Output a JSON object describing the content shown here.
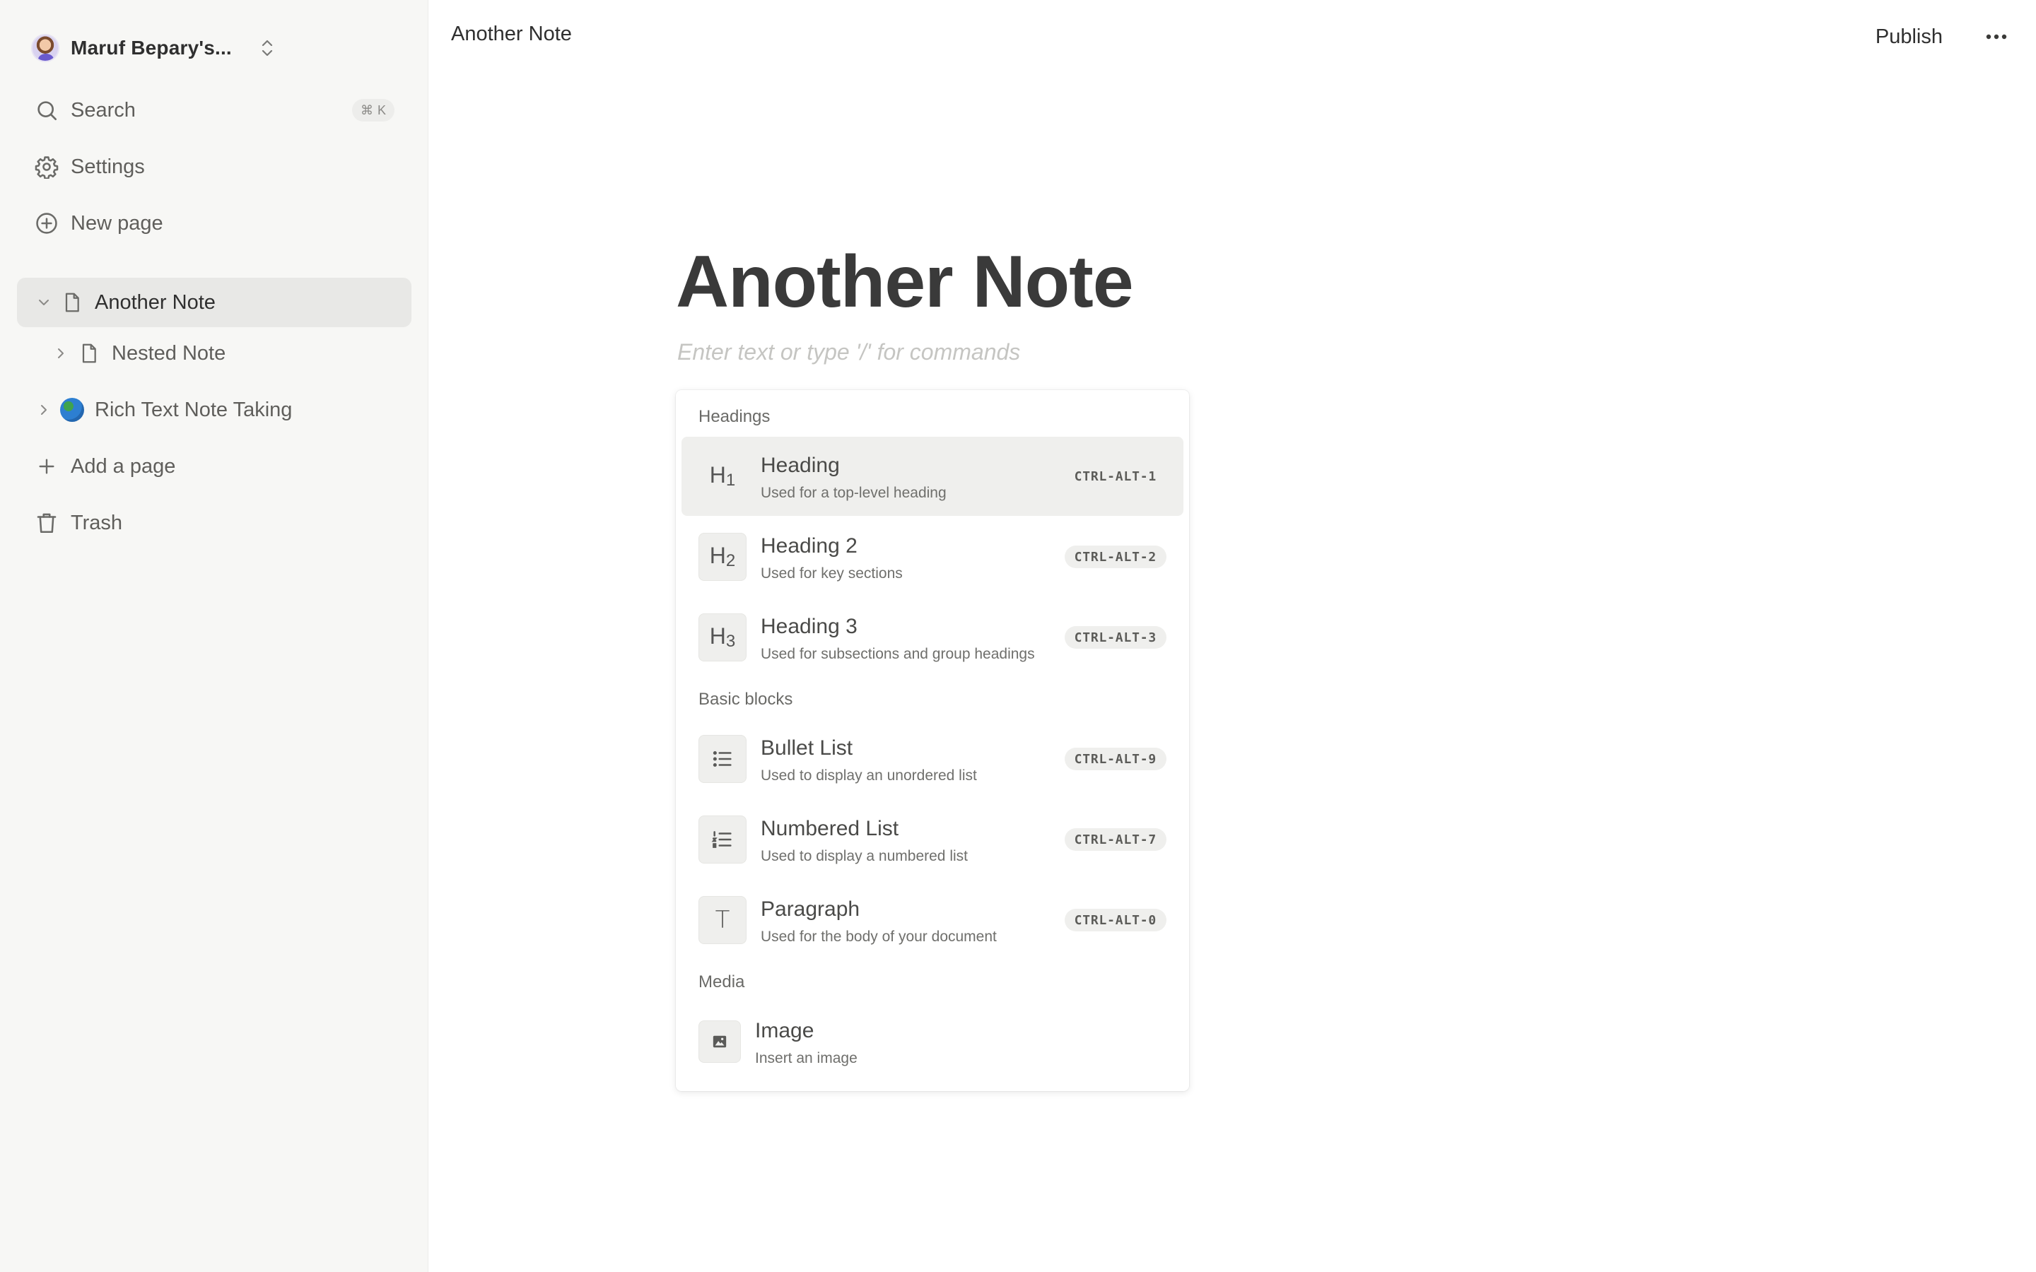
{
  "sidebar": {
    "workspace_name": "Maruf Bepary's...",
    "nav": {
      "search_label": "Search",
      "search_shortcut_symbol": "⌘",
      "search_shortcut_key": "K",
      "settings_label": "Settings",
      "new_page_label": "New page"
    },
    "tree": [
      {
        "label": "Another Note",
        "expanded": true,
        "active": true,
        "icon": "page-icon"
      },
      {
        "label": "Nested Note",
        "expanded": false,
        "active": false,
        "icon": "page-icon"
      },
      {
        "label": "Rich Text Note Taking",
        "expanded": false,
        "active": false,
        "icon": "globe-emoji"
      }
    ],
    "add_page_label": "Add a page",
    "trash_label": "Trash"
  },
  "topbar": {
    "breadcrumb": "Another Note",
    "publish_label": "Publish",
    "more_icon": "ellipsis-icon"
  },
  "editor": {
    "title": "Another Note",
    "placeholder": "Enter text or type '/' for commands"
  },
  "slash_menu": {
    "sections": [
      {
        "label": "Headings"
      },
      {
        "label": "Basic blocks"
      },
      {
        "label": "Media"
      }
    ],
    "items": [
      {
        "title": "Heading",
        "description": "Used for a top-level heading",
        "shortcut": "CTRL-ALT-1",
        "icon": "h1-icon",
        "glyph": "H",
        "glyph_sub": "1",
        "highlighted": true
      },
      {
        "title": "Heading 2",
        "description": "Used for key sections",
        "shortcut": "CTRL-ALT-2",
        "icon": "h2-icon",
        "glyph": "H",
        "glyph_sub": "2"
      },
      {
        "title": "Heading 3",
        "description": "Used for subsections and group headings",
        "shortcut": "CTRL-ALT-3",
        "icon": "h3-icon",
        "glyph": "H",
        "glyph_sub": "3"
      },
      {
        "title": "Bullet List",
        "description": "Used to display an unordered list",
        "shortcut": "CTRL-ALT-9",
        "icon": "bullet-list-icon"
      },
      {
        "title": "Numbered List",
        "description": "Used to display a numbered list",
        "shortcut": "CTRL-ALT-7",
        "icon": "numbered-list-icon"
      },
      {
        "title": "Paragraph",
        "description": "Used for the body of your document",
        "shortcut": "CTRL-ALT-0",
        "icon": "paragraph-icon",
        "glyph": "T"
      },
      {
        "title": "Image",
        "description": "Insert an image",
        "icon": "image-icon"
      }
    ]
  }
}
